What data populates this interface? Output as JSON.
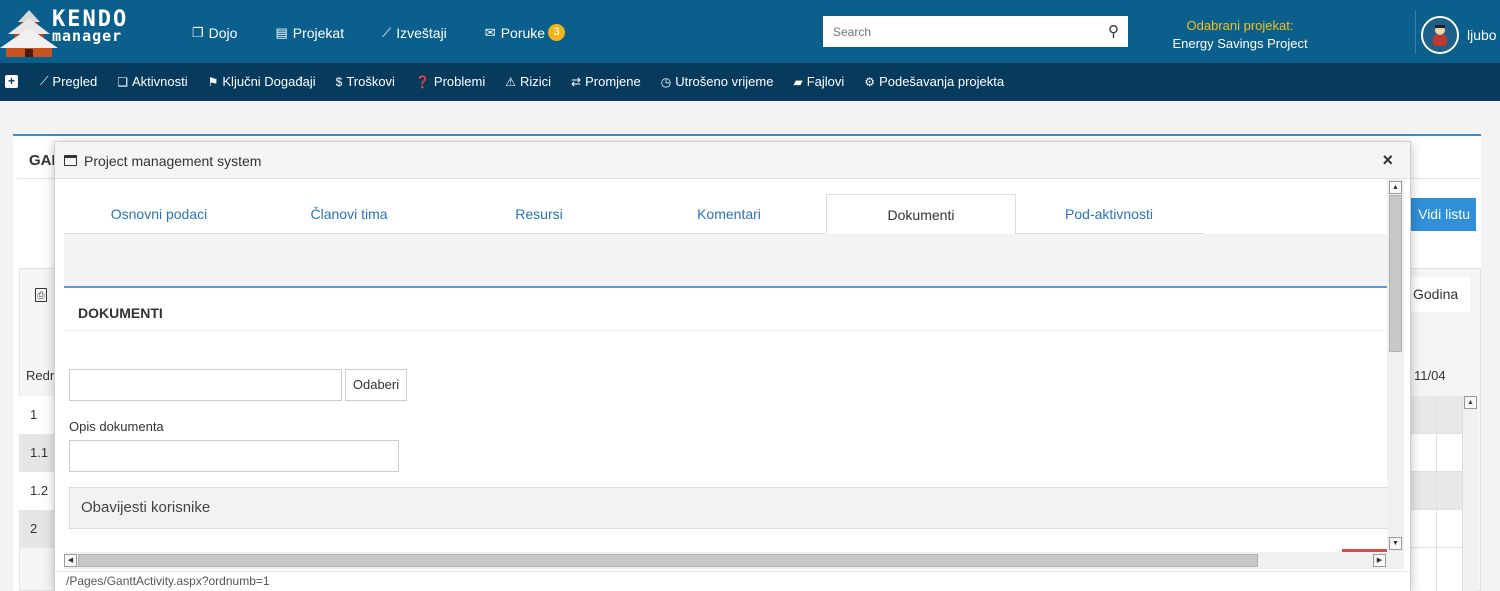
{
  "topbar": {
    "logo": {
      "line1": "KENDO",
      "line2": "manager"
    },
    "nav": [
      {
        "label": "Dojo",
        "icon": "copy-icon"
      },
      {
        "label": "Projekat",
        "icon": "document-icon"
      },
      {
        "label": "Izveštaji",
        "icon": "line-chart-icon"
      },
      {
        "label": "Poruke",
        "icon": "envelope-icon",
        "badge": "3"
      }
    ],
    "search": {
      "placeholder": "Search",
      "value": ""
    },
    "project": {
      "label": "Odabrani projekat:",
      "name": "Energy Savings Project"
    },
    "user": {
      "name": "ljubo"
    }
  },
  "subnav": {
    "items": [
      {
        "label": "Pregled",
        "icon": "line-chart-icon"
      },
      {
        "label": "Aktivnosti",
        "icon": "files-icon"
      },
      {
        "label": "Ključni Događaji",
        "icon": "flag-icon"
      },
      {
        "label": "Troškovi",
        "icon": "dollar-icon"
      },
      {
        "label": "Problemi",
        "icon": "question-icon"
      },
      {
        "label": "Rizici",
        "icon": "warning-icon"
      },
      {
        "label": "Promjene",
        "icon": "exchange-icon"
      },
      {
        "label": "Utrošeno vrijeme",
        "icon": "clock-icon"
      },
      {
        "label": "Fajlovi",
        "icon": "folder-icon"
      },
      {
        "label": "Podešavanja projekta",
        "icon": "cogs-icon"
      }
    ]
  },
  "background": {
    "title": "GAI",
    "vidi_button": "Vidi listu",
    "godina": "Godina",
    "redni": "Redn",
    "date": "11/04",
    "rows": [
      "1",
      "1.1",
      "1.2",
      "2"
    ]
  },
  "modal": {
    "title": "Project management system",
    "close": "×",
    "tabs": [
      {
        "label": "Osnovni podaci",
        "active": false
      },
      {
        "label": "Članovi tima",
        "active": false
      },
      {
        "label": "Resursi",
        "active": false
      },
      {
        "label": "Komentari",
        "active": false
      },
      {
        "label": "Dokumenti",
        "active": true
      },
      {
        "label": "Pod-aktivnosti",
        "active": false
      }
    ],
    "section_title": "DOKUMENTI",
    "file_input_value": "",
    "file_button": "Odaberi",
    "opis_label": "Opis dokumenta",
    "opis_value": "",
    "notify_label": "Obavijesti korisnike",
    "status_url": "/Pages/GanttActivity.aspx?ordnumb=1"
  },
  "colors": {
    "topbar": "#0a5f8c",
    "subbar": "#073b5e",
    "accent": "#2f8fd8",
    "badge": "#f0b41c",
    "project_label": "#f0c020"
  }
}
